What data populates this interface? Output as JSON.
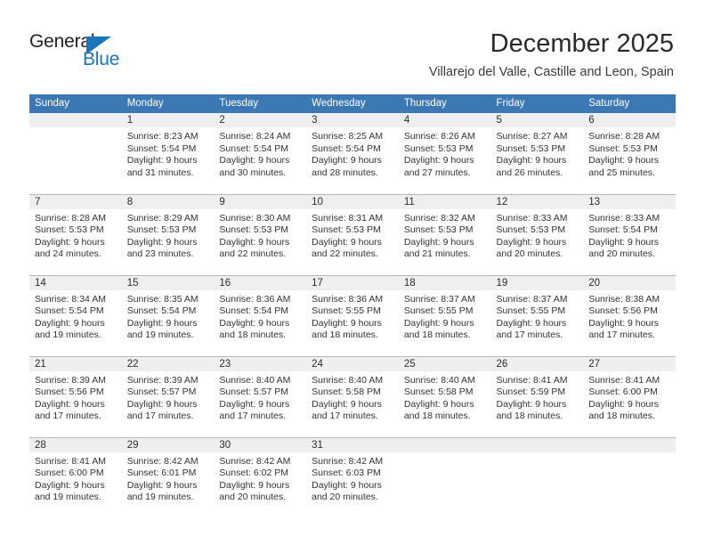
{
  "logo": {
    "name_top": "General",
    "name_bottom": "Blue",
    "triangle_icon": "blue-triangle-icon",
    "color_top": "#231f20",
    "color_bottom": "#1b75bc"
  },
  "header": {
    "month_title": "December 2025",
    "location": "Villarejo del Valle, Castille and Leon, Spain"
  },
  "colors": {
    "header_row_bg": "#3b78b4",
    "header_row_text": "#ffffff",
    "daynum_band_bg": "#efefef",
    "cell_text": "#333333",
    "grid_line": "#b9b9b9"
  },
  "weekdays": [
    "Sunday",
    "Monday",
    "Tuesday",
    "Wednesday",
    "Thursday",
    "Friday",
    "Saturday"
  ],
  "weeks": [
    [
      {
        "day": "",
        "sunrise": "",
        "sunset": "",
        "daylight_1": "",
        "daylight_2": ""
      },
      {
        "day": "1",
        "sunrise": "Sunrise: 8:23 AM",
        "sunset": "Sunset: 5:54 PM",
        "daylight_1": "Daylight: 9 hours",
        "daylight_2": "and 31 minutes."
      },
      {
        "day": "2",
        "sunrise": "Sunrise: 8:24 AM",
        "sunset": "Sunset: 5:54 PM",
        "daylight_1": "Daylight: 9 hours",
        "daylight_2": "and 30 minutes."
      },
      {
        "day": "3",
        "sunrise": "Sunrise: 8:25 AM",
        "sunset": "Sunset: 5:54 PM",
        "daylight_1": "Daylight: 9 hours",
        "daylight_2": "and 28 minutes."
      },
      {
        "day": "4",
        "sunrise": "Sunrise: 8:26 AM",
        "sunset": "Sunset: 5:53 PM",
        "daylight_1": "Daylight: 9 hours",
        "daylight_2": "and 27 minutes."
      },
      {
        "day": "5",
        "sunrise": "Sunrise: 8:27 AM",
        "sunset": "Sunset: 5:53 PM",
        "daylight_1": "Daylight: 9 hours",
        "daylight_2": "and 26 minutes."
      },
      {
        "day": "6",
        "sunrise": "Sunrise: 8:28 AM",
        "sunset": "Sunset: 5:53 PM",
        "daylight_1": "Daylight: 9 hours",
        "daylight_2": "and 25 minutes."
      }
    ],
    [
      {
        "day": "7",
        "sunrise": "Sunrise: 8:28 AM",
        "sunset": "Sunset: 5:53 PM",
        "daylight_1": "Daylight: 9 hours",
        "daylight_2": "and 24 minutes."
      },
      {
        "day": "8",
        "sunrise": "Sunrise: 8:29 AM",
        "sunset": "Sunset: 5:53 PM",
        "daylight_1": "Daylight: 9 hours",
        "daylight_2": "and 23 minutes."
      },
      {
        "day": "9",
        "sunrise": "Sunrise: 8:30 AM",
        "sunset": "Sunset: 5:53 PM",
        "daylight_1": "Daylight: 9 hours",
        "daylight_2": "and 22 minutes."
      },
      {
        "day": "10",
        "sunrise": "Sunrise: 8:31 AM",
        "sunset": "Sunset: 5:53 PM",
        "daylight_1": "Daylight: 9 hours",
        "daylight_2": "and 22 minutes."
      },
      {
        "day": "11",
        "sunrise": "Sunrise: 8:32 AM",
        "sunset": "Sunset: 5:53 PM",
        "daylight_1": "Daylight: 9 hours",
        "daylight_2": "and 21 minutes."
      },
      {
        "day": "12",
        "sunrise": "Sunrise: 8:33 AM",
        "sunset": "Sunset: 5:53 PM",
        "daylight_1": "Daylight: 9 hours",
        "daylight_2": "and 20 minutes."
      },
      {
        "day": "13",
        "sunrise": "Sunrise: 8:33 AM",
        "sunset": "Sunset: 5:54 PM",
        "daylight_1": "Daylight: 9 hours",
        "daylight_2": "and 20 minutes."
      }
    ],
    [
      {
        "day": "14",
        "sunrise": "Sunrise: 8:34 AM",
        "sunset": "Sunset: 5:54 PM",
        "daylight_1": "Daylight: 9 hours",
        "daylight_2": "and 19 minutes."
      },
      {
        "day": "15",
        "sunrise": "Sunrise: 8:35 AM",
        "sunset": "Sunset: 5:54 PM",
        "daylight_1": "Daylight: 9 hours",
        "daylight_2": "and 19 minutes."
      },
      {
        "day": "16",
        "sunrise": "Sunrise: 8:36 AM",
        "sunset": "Sunset: 5:54 PM",
        "daylight_1": "Daylight: 9 hours",
        "daylight_2": "and 18 minutes."
      },
      {
        "day": "17",
        "sunrise": "Sunrise: 8:36 AM",
        "sunset": "Sunset: 5:55 PM",
        "daylight_1": "Daylight: 9 hours",
        "daylight_2": "and 18 minutes."
      },
      {
        "day": "18",
        "sunrise": "Sunrise: 8:37 AM",
        "sunset": "Sunset: 5:55 PM",
        "daylight_1": "Daylight: 9 hours",
        "daylight_2": "and 18 minutes."
      },
      {
        "day": "19",
        "sunrise": "Sunrise: 8:37 AM",
        "sunset": "Sunset: 5:55 PM",
        "daylight_1": "Daylight: 9 hours",
        "daylight_2": "and 17 minutes."
      },
      {
        "day": "20",
        "sunrise": "Sunrise: 8:38 AM",
        "sunset": "Sunset: 5:56 PM",
        "daylight_1": "Daylight: 9 hours",
        "daylight_2": "and 17 minutes."
      }
    ],
    [
      {
        "day": "21",
        "sunrise": "Sunrise: 8:39 AM",
        "sunset": "Sunset: 5:56 PM",
        "daylight_1": "Daylight: 9 hours",
        "daylight_2": "and 17 minutes."
      },
      {
        "day": "22",
        "sunrise": "Sunrise: 8:39 AM",
        "sunset": "Sunset: 5:57 PM",
        "daylight_1": "Daylight: 9 hours",
        "daylight_2": "and 17 minutes."
      },
      {
        "day": "23",
        "sunrise": "Sunrise: 8:40 AM",
        "sunset": "Sunset: 5:57 PM",
        "daylight_1": "Daylight: 9 hours",
        "daylight_2": "and 17 minutes."
      },
      {
        "day": "24",
        "sunrise": "Sunrise: 8:40 AM",
        "sunset": "Sunset: 5:58 PM",
        "daylight_1": "Daylight: 9 hours",
        "daylight_2": "and 17 minutes."
      },
      {
        "day": "25",
        "sunrise": "Sunrise: 8:40 AM",
        "sunset": "Sunset: 5:58 PM",
        "daylight_1": "Daylight: 9 hours",
        "daylight_2": "and 18 minutes."
      },
      {
        "day": "26",
        "sunrise": "Sunrise: 8:41 AM",
        "sunset": "Sunset: 5:59 PM",
        "daylight_1": "Daylight: 9 hours",
        "daylight_2": "and 18 minutes."
      },
      {
        "day": "27",
        "sunrise": "Sunrise: 8:41 AM",
        "sunset": "Sunset: 6:00 PM",
        "daylight_1": "Daylight: 9 hours",
        "daylight_2": "and 18 minutes."
      }
    ],
    [
      {
        "day": "28",
        "sunrise": "Sunrise: 8:41 AM",
        "sunset": "Sunset: 6:00 PM",
        "daylight_1": "Daylight: 9 hours",
        "daylight_2": "and 19 minutes."
      },
      {
        "day": "29",
        "sunrise": "Sunrise: 8:42 AM",
        "sunset": "Sunset: 6:01 PM",
        "daylight_1": "Daylight: 9 hours",
        "daylight_2": "and 19 minutes."
      },
      {
        "day": "30",
        "sunrise": "Sunrise: 8:42 AM",
        "sunset": "Sunset: 6:02 PM",
        "daylight_1": "Daylight: 9 hours",
        "daylight_2": "and 20 minutes."
      },
      {
        "day": "31",
        "sunrise": "Sunrise: 8:42 AM",
        "sunset": "Sunset: 6:03 PM",
        "daylight_1": "Daylight: 9 hours",
        "daylight_2": "and 20 minutes."
      },
      {
        "day": "",
        "sunrise": "",
        "sunset": "",
        "daylight_1": "",
        "daylight_2": ""
      },
      {
        "day": "",
        "sunrise": "",
        "sunset": "",
        "daylight_1": "",
        "daylight_2": ""
      },
      {
        "day": "",
        "sunrise": "",
        "sunset": "",
        "daylight_1": "",
        "daylight_2": ""
      }
    ]
  ]
}
